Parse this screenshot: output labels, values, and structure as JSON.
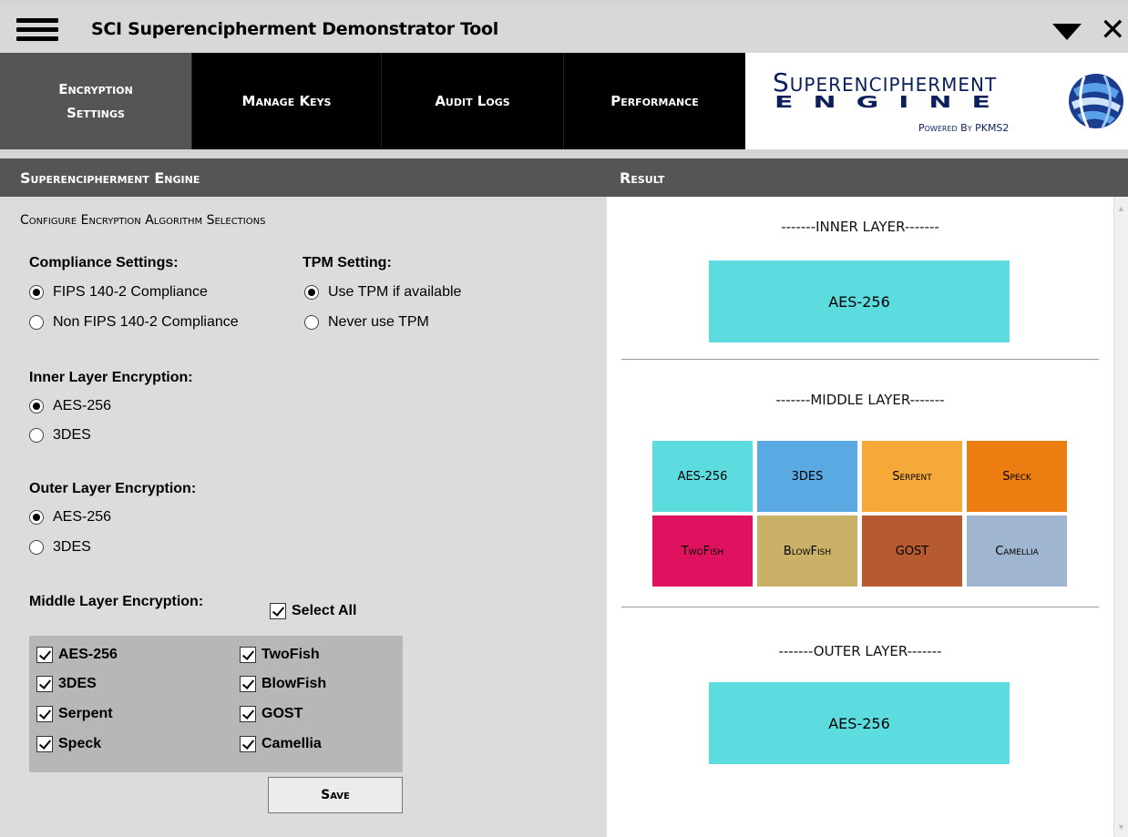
{
  "window": {
    "title": "SCI Superencipherment Demonstrator Tool"
  },
  "tabs": [
    {
      "label": "Encryption Settings",
      "active": true
    },
    {
      "label": "Manage Keys",
      "active": false
    },
    {
      "label": "Audit Logs",
      "active": false
    },
    {
      "label": "Performance",
      "active": false
    }
  ],
  "logo": {
    "line1": "Superencipherment",
    "line2": "ENGINE",
    "sub": "Powered By PKMS2"
  },
  "left_panel": {
    "header": "Superencipherment Engine",
    "title": "Configure Encryption Algorithm Selections",
    "compliance": {
      "label": "Compliance Settings:",
      "options": [
        "FIPS 140-2 Compliance",
        "Non FIPS 140-2 Compliance"
      ],
      "selected": "FIPS 140-2 Compliance"
    },
    "tpm": {
      "label": "TPM Setting:",
      "options": [
        "Use TPM if available",
        "Never use TPM"
      ],
      "selected": "Use TPM if available"
    },
    "inner": {
      "label": "Inner Layer Encryption:",
      "options": [
        "AES-256",
        "3DES"
      ],
      "selected": "AES-256"
    },
    "outer": {
      "label": "Outer Layer Encryption:",
      "options": [
        "AES-256",
        "3DES"
      ],
      "selected": "AES-256"
    },
    "middle": {
      "label": "Middle Layer Encryption:",
      "select_all": "Select All",
      "left_items": [
        "AES-256",
        "3DES",
        "Serpent",
        "Speck"
      ],
      "right_items": [
        "TwoFish",
        "BlowFish",
        "GOST",
        "Camellia"
      ]
    },
    "save_label": "Save"
  },
  "right_panel": {
    "header": "Result",
    "inner_label": "-------INNER LAYER-------",
    "inner_value": "AES-256",
    "middle_label": "-------MIDDLE LAYER-------",
    "middle_tiles": [
      {
        "label": "AES-256",
        "color": "#5ddce0"
      },
      {
        "label": "3DES",
        "color": "#5aa9e3"
      },
      {
        "label": "Serpent",
        "color": "#f4a939"
      },
      {
        "label": "Speck",
        "color": "#ec7d10"
      },
      {
        "label": "TwoFish",
        "color": "#e0115f"
      },
      {
        "label": "BlowFish",
        "color": "#c9b268"
      },
      {
        "label": "GOST",
        "color": "#b65a31"
      },
      {
        "label": "Camellia",
        "color": "#9fb5d0"
      }
    ],
    "outer_label": "-------OUTER LAYER-------",
    "outer_value": "AES-256"
  }
}
